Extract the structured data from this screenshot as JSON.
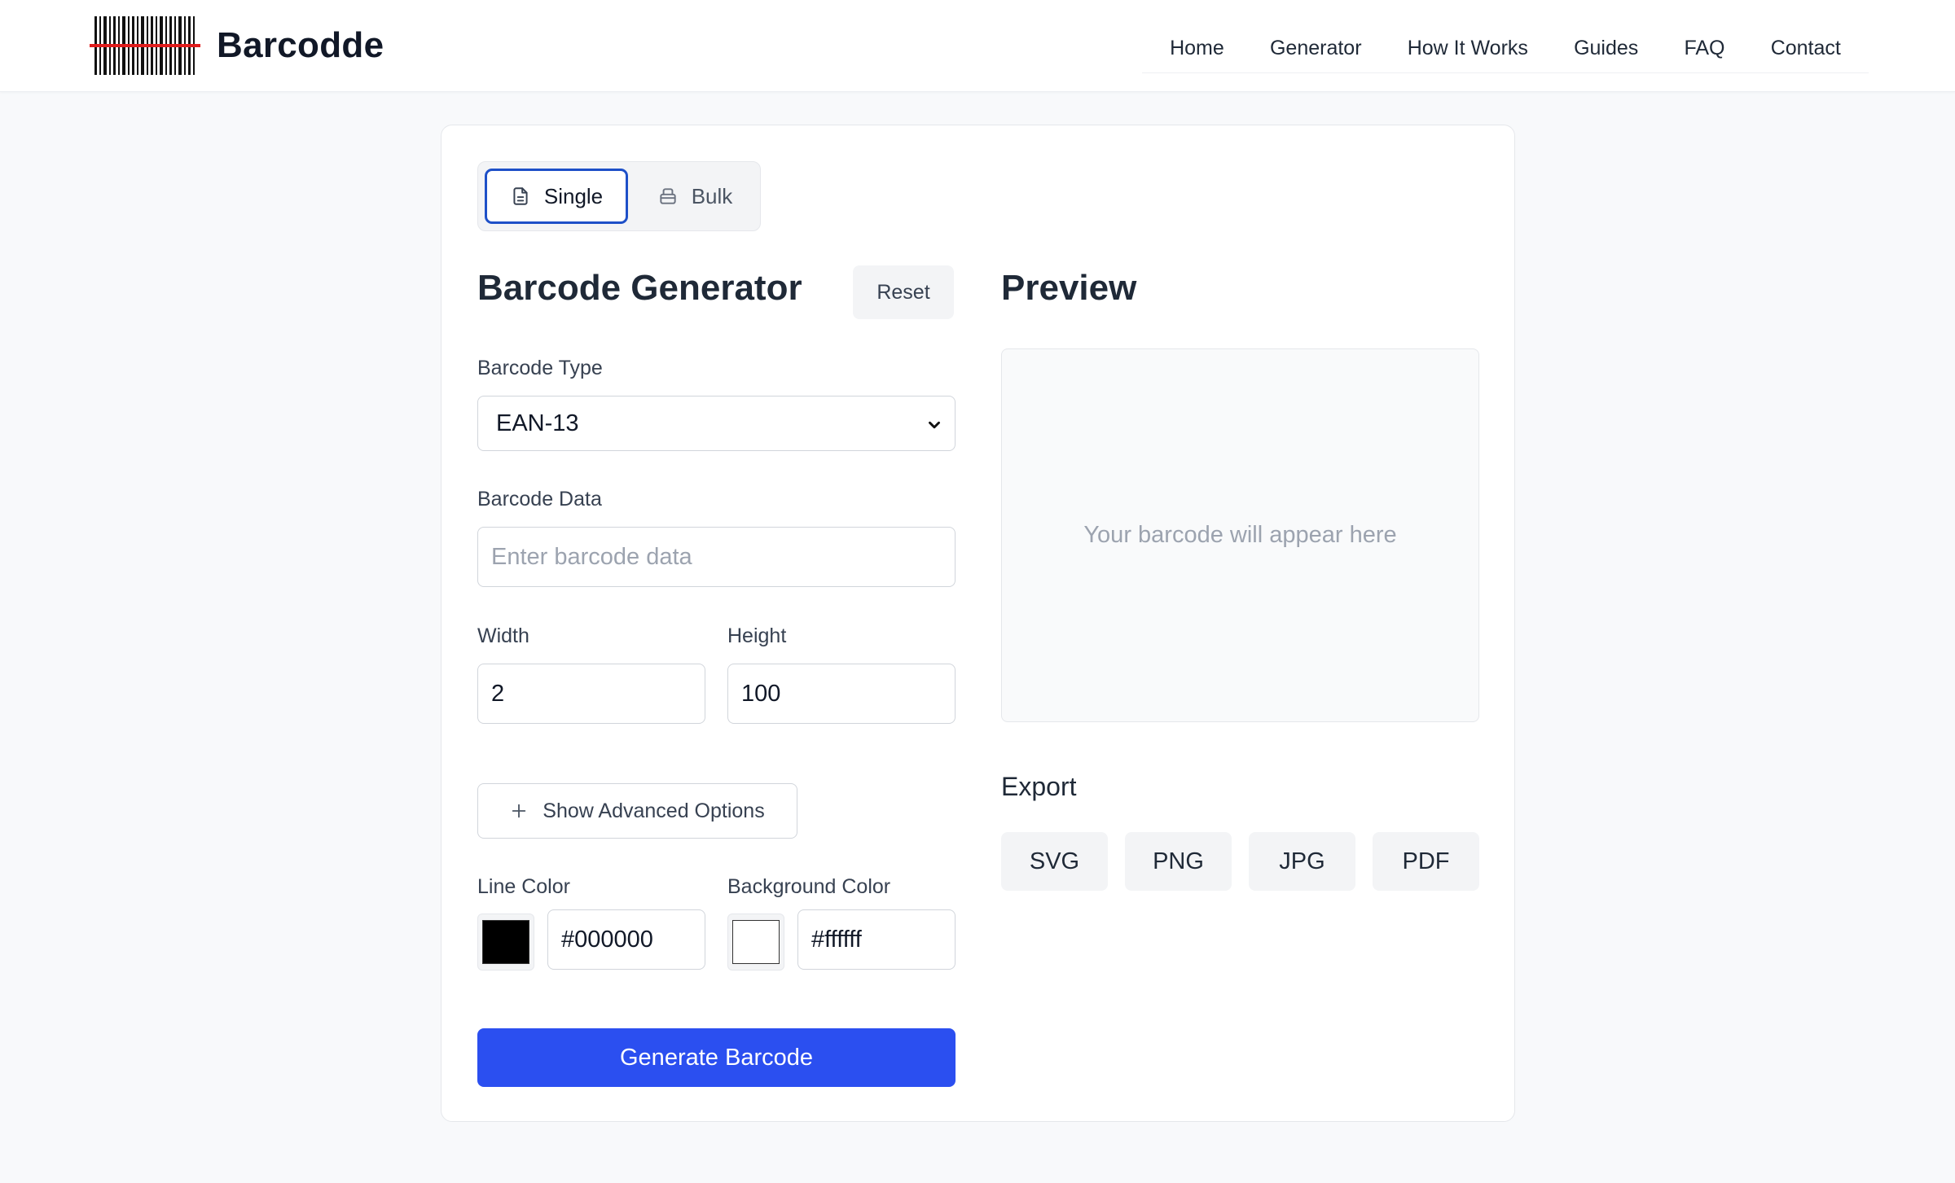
{
  "header": {
    "brand": "Barcodde",
    "nav": [
      "Home",
      "Generator",
      "How It Works",
      "Guides",
      "FAQ",
      "Contact"
    ]
  },
  "tabs": {
    "single": "Single",
    "bulk": "Bulk",
    "active": "Single"
  },
  "form": {
    "title": "Barcode Generator",
    "reset_label": "Reset",
    "barcode_type_label": "Barcode Type",
    "barcode_type_value": "EAN-13",
    "barcode_data_label": "Barcode Data",
    "barcode_data_placeholder": "Enter barcode data",
    "width_label": "Width",
    "width_value": "2",
    "height_label": "Height",
    "height_value": "100",
    "advanced_label": "Show Advanced Options",
    "line_color_label": "Line Color",
    "line_color_value": "#000000",
    "bg_color_label": "Background Color",
    "bg_color_value": "#ffffff",
    "generate_label": "Generate Barcode"
  },
  "preview": {
    "title": "Preview",
    "placeholder": "Your barcode will appear here"
  },
  "export": {
    "title": "Export",
    "formats": [
      "SVG",
      "PNG",
      "JPG",
      "PDF"
    ]
  },
  "colors": {
    "accent": "#2b4ff0",
    "tab_active_border": "#1e50c8",
    "logo_red_line": "#e11d1d"
  }
}
